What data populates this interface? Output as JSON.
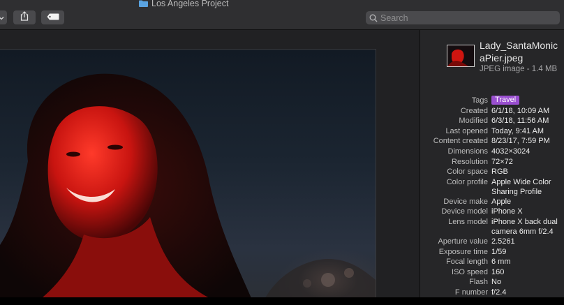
{
  "window": {
    "title": "Los Angeles Project"
  },
  "search": {
    "placeholder": "Search"
  },
  "file": {
    "name": "Lady_SantaMonicaPier.jpeg",
    "kind": "JPEG image - 1.4 MB"
  },
  "colors": {
    "tag": "#9a4fd0",
    "toolbar": "#2f2f31",
    "inspector": "#262628"
  },
  "icons": [
    "folder-icon",
    "chevron-down-icon",
    "share-icon",
    "tag-icon",
    "search-icon"
  ],
  "metadata": [
    {
      "key": "Tags",
      "value": "Travel",
      "tag": true
    },
    {
      "key": "Created",
      "value": "6/1/18, 10:09 AM"
    },
    {
      "key": "Modified",
      "value": "6/3/18, 11:56 AM"
    },
    {
      "key": "Last opened",
      "value": "Today, 9:41 AM"
    },
    {
      "key": "Content created",
      "value": "8/23/17, 7:59 PM"
    },
    {
      "key": "Dimensions",
      "value": "4032×3024"
    },
    {
      "key": "Resolution",
      "value": "72×72"
    },
    {
      "key": "Color space",
      "value": "RGB"
    },
    {
      "key": "Color profile",
      "value": "Apple Wide Color",
      "value2": "Sharing Profile"
    },
    {
      "key": "Device make",
      "value": "Apple"
    },
    {
      "key": "Device model",
      "value": "iPhone X"
    },
    {
      "key": "Lens model",
      "value": "iPhone X back dual",
      "value2": "camera 6mm f/2.4"
    },
    {
      "key": "Aperture value",
      "value": "2.5261"
    },
    {
      "key": "Exposure time",
      "value": "1/59"
    },
    {
      "key": "Focal length",
      "value": "6 mm"
    },
    {
      "key": "ISO speed",
      "value": "160"
    },
    {
      "key": "Flash",
      "value": "No"
    },
    {
      "key": "F number",
      "value": "f/2.4"
    }
  ]
}
